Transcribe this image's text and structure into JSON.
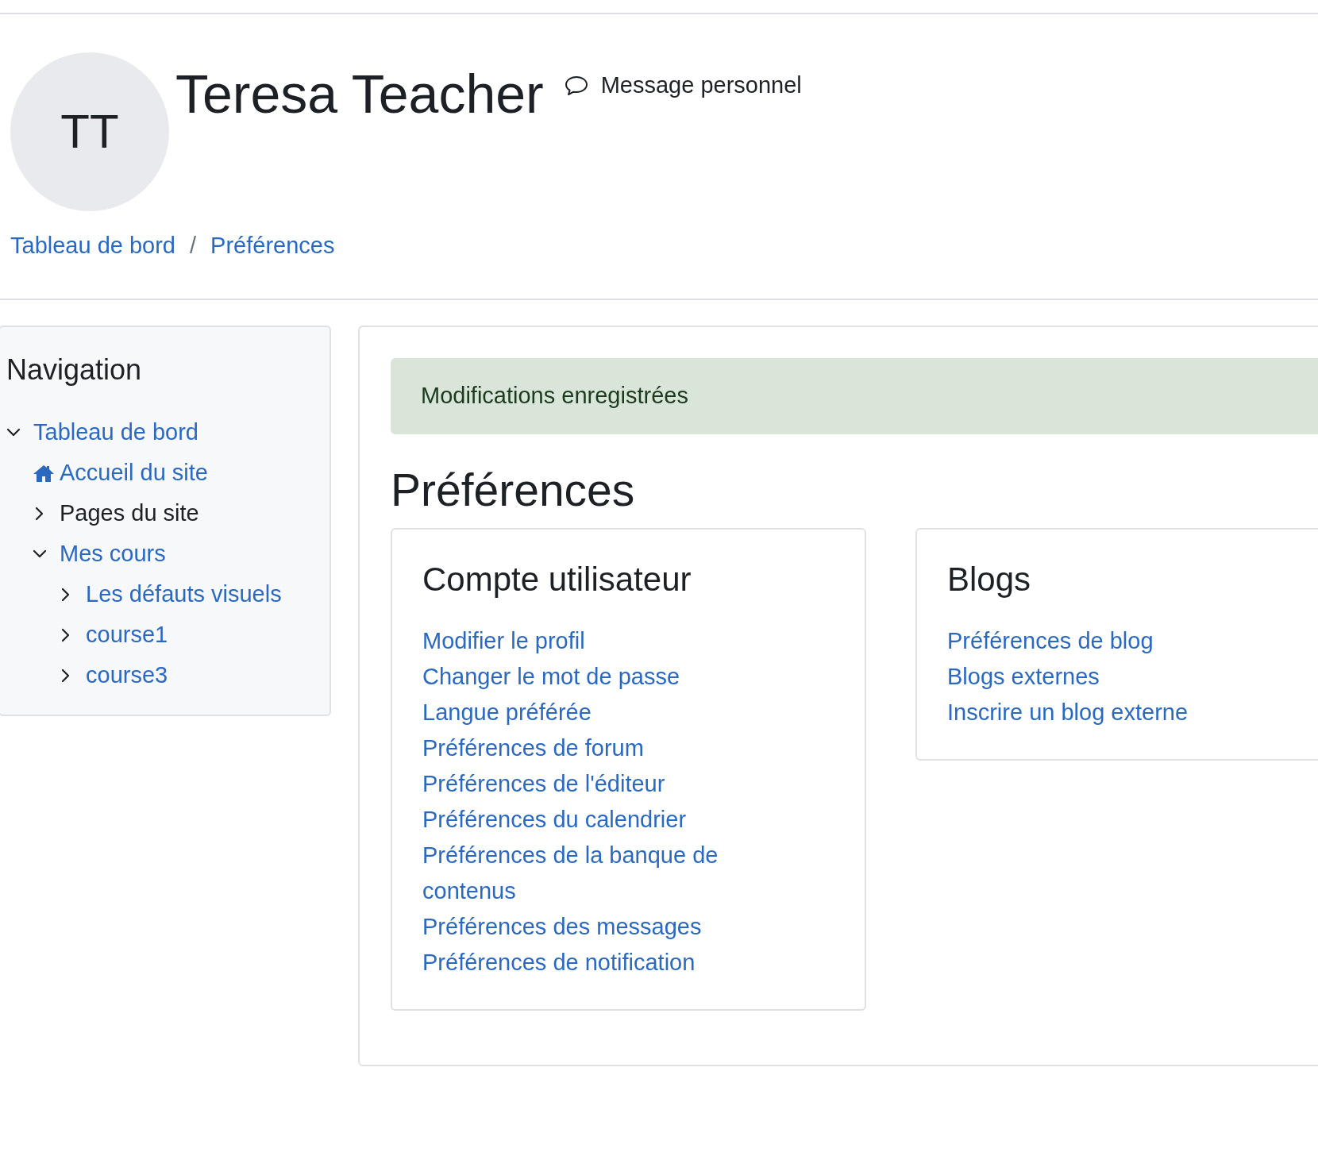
{
  "header": {
    "avatar_initials": "TT",
    "name": "Teresa Teacher",
    "message_link": "Message personnel"
  },
  "breadcrumb": {
    "separator": "/",
    "items": [
      {
        "label": "Tableau de bord"
      },
      {
        "label": "Préférences"
      }
    ]
  },
  "navigation": {
    "title": "Navigation",
    "items": [
      {
        "label": "Tableau de bord",
        "kind": "link",
        "expanded": true,
        "children": [
          {
            "label": "Accueil du site",
            "kind": "home"
          },
          {
            "label": "Pages du site",
            "kind": "text",
            "expanded": false
          },
          {
            "label": "Mes cours",
            "kind": "link",
            "expanded": true,
            "children": [
              {
                "label": "Les défauts visuels",
                "kind": "link",
                "expanded": false
              },
              {
                "label": "course1",
                "kind": "link",
                "expanded": false
              },
              {
                "label": "course3",
                "kind": "link",
                "expanded": false
              }
            ]
          }
        ]
      }
    ]
  },
  "main": {
    "alert": "Modifications enregistrées",
    "heading": "Préférences",
    "cards": [
      {
        "title": "Compte utilisateur",
        "links": [
          "Modifier le profil",
          "Changer le mot de passe",
          "Langue préférée",
          "Préférences de forum",
          "Préférences de l'éditeur",
          "Préférences du calendrier",
          "Préférences de la banque de contenus",
          "Préférences des messages",
          "Préférences de notification"
        ]
      },
      {
        "title": "Blogs",
        "links": [
          "Préférences de blog",
          "Blogs externes",
          "Inscrire un blog externe"
        ]
      }
    ]
  }
}
